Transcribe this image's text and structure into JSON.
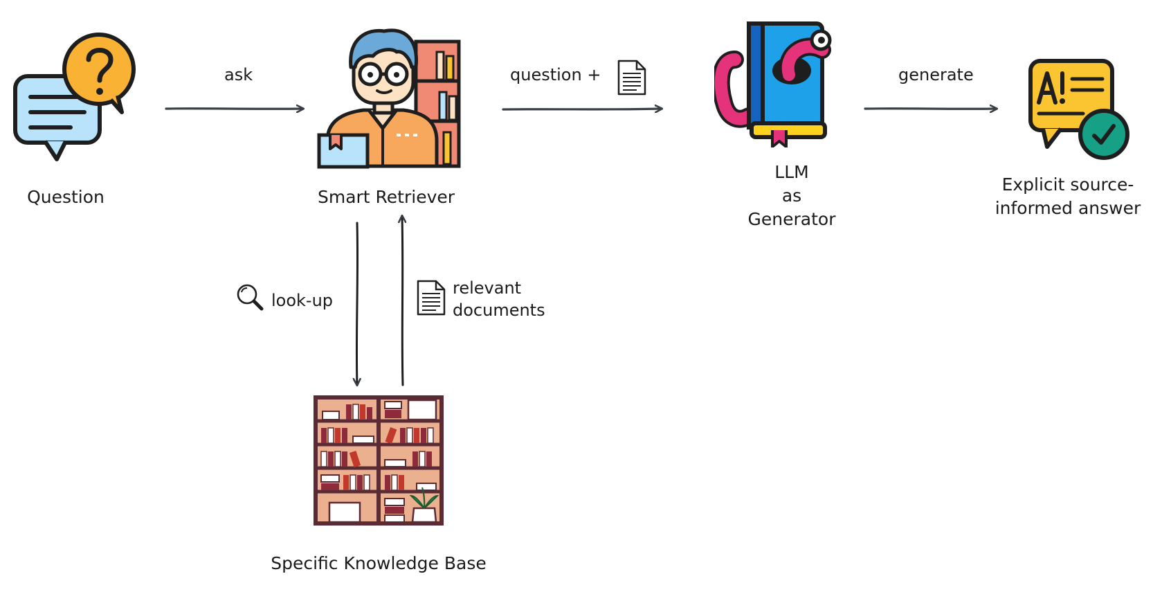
{
  "diagram": {
    "nodes": {
      "question": {
        "label": "Question",
        "icon": "speech-bubbles-question-icon"
      },
      "retriever": {
        "label": "Smart Retriever",
        "icon": "librarian-icon"
      },
      "llm": {
        "label_lines": [
          "LLM",
          "as",
          "Generator"
        ],
        "icon": "bookworm-book-icon"
      },
      "answer": {
        "label_lines": [
          "Explicit source-",
          "informed answer"
        ],
        "icon": "answer-check-icon"
      },
      "kb": {
        "label": "Specific Knowledge Base",
        "icon": "bookshelf-icon"
      }
    },
    "edges": {
      "ask": {
        "label": "ask"
      },
      "question_plus": {
        "label": "question +",
        "icon": "document-icon"
      },
      "generate": {
        "label": "generate"
      },
      "lookup": {
        "label": "look-up",
        "icon": "magnifier-icon"
      },
      "relevant": {
        "label_lines": [
          "relevant",
          "documents"
        ],
        "icon": "document-icon"
      }
    },
    "colors": {
      "arrow": "#3a3f45",
      "outline": "#1e1e1e",
      "bubble_blue": "#b8e3fb",
      "bubble_orange": "#f9b233",
      "skin": "#fde2c4",
      "hair": "#6aa9d8",
      "shirt": "#f7a85c",
      "shelf_red": "#f08a74",
      "book_blue": "#1fa1ea",
      "book_yellow": "#ffd21f",
      "worm_pink": "#e4337a",
      "answer_yellow": "#fbc531",
      "check_green": "#16a085",
      "shelf_brown": "#eab08f",
      "book_dark": "#8e2b3a"
    }
  }
}
